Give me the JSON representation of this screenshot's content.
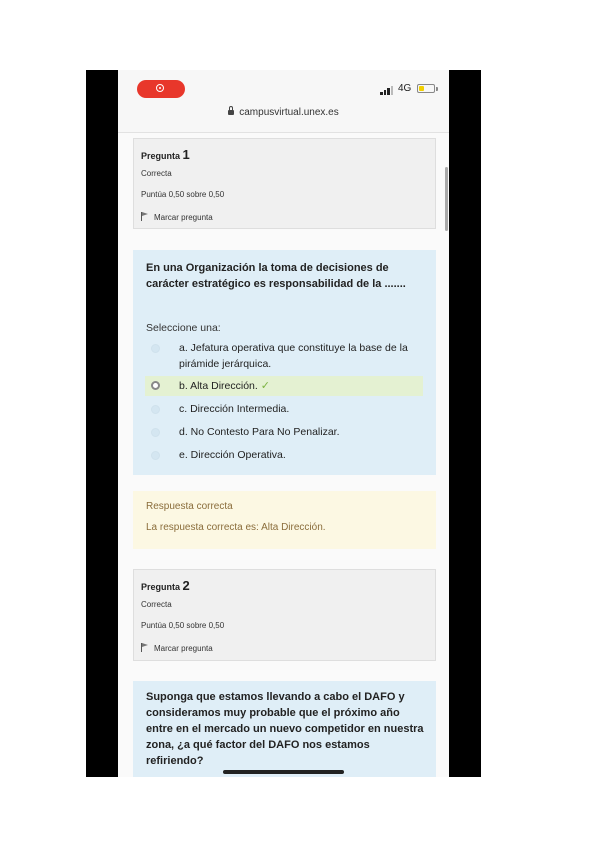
{
  "status_bar": {
    "network": "4G",
    "url": "campusvirtual.unex.es",
    "battery_color": "#f2d000",
    "record_color": "#e8372b"
  },
  "questions": [
    {
      "label": "Pregunta",
      "number": "1",
      "state": "Correcta",
      "score": "Puntúa 0,50 sobre 0,50",
      "flag_label": "Marcar pregunta",
      "text": "En una Organización la toma de decisiones de carácter estratégico es responsabilidad de la .......",
      "select_label": "Seleccione una:",
      "options": [
        {
          "label": "a. Jefatura operativa que constituye la base de la pirámide jerárquica.",
          "selected": false
        },
        {
          "label": "b. Alta Dirección.",
          "selected": true
        },
        {
          "label": "c. Dirección Intermedia.",
          "selected": false
        },
        {
          "label": "d. No Contesto Para No Penalizar.",
          "selected": false
        },
        {
          "label": "e. Dirección Operativa.",
          "selected": false
        }
      ],
      "feedback_title": "Respuesta correcta",
      "feedback_text": "La respuesta correcta es: Alta Dirección."
    },
    {
      "label": "Pregunta",
      "number": "2",
      "state": "Correcta",
      "score": "Puntúa 0,50 sobre 0,50",
      "flag_label": "Marcar pregunta",
      "text": "Suponga que estamos llevando a cabo el DAFO y consideramos muy probable que el próximo año entre en el mercado un nuevo competidor en nuestra zona, ¿a qué factor del DAFO nos estamos refiriendo?"
    }
  ],
  "colors": {
    "question_bg": "#dfeef7",
    "info_bg": "#f0f0f0",
    "feedback_bg": "#fcf8e3",
    "feedback_text": "#8a6d3b",
    "selected_bg": "#e4f1d2",
    "check": "#7cb342"
  }
}
